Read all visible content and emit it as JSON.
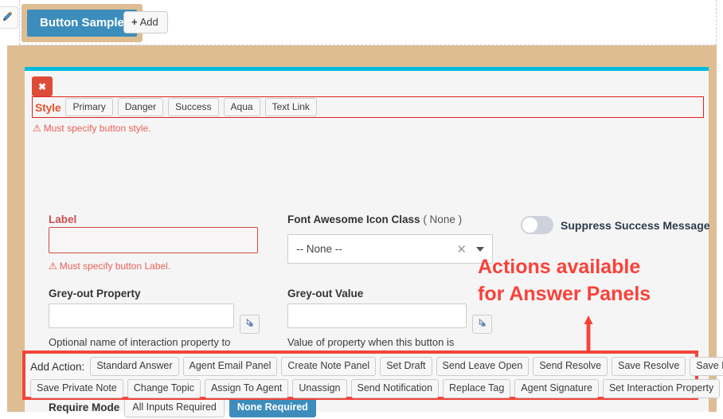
{
  "designer": {
    "edit_icon": "pencil-icon",
    "sample_tab_label": "Button Sample",
    "add_tab_label": "Add",
    "add_tab_plus": "+"
  },
  "panel": {
    "close_glyph": "✖",
    "style": {
      "label": "Style",
      "options": [
        "Primary",
        "Danger",
        "Success",
        "Aqua",
        "Text Link"
      ],
      "error": "Must specify button style.",
      "error_icon": "⚠"
    },
    "label_field": {
      "label": "Label",
      "value": "",
      "error": "Must specify button Label.",
      "error_icon": "⚠"
    },
    "font_awesome": {
      "label": "Font Awesome Icon Class",
      "label_note": "( None )",
      "selected": "-- None --",
      "clear_glyph": "✕",
      "caret": "caret-down-icon"
    },
    "suppress_toggle": {
      "label": "Suppress Success Message",
      "state": "off"
    },
    "greyout_property": {
      "label": "Grey-out Property",
      "value": "",
      "picker_icon": "pointer-icon",
      "helper": "Optional name of interaction property to check to determine if this button is rendered different."
    },
    "greyout_value": {
      "label": "Grey-out Value",
      "value": "",
      "picker_icon": "pointer-icon",
      "helper": "Value of property when this button is normal. If the property is NOT this value, the button will be colored grey."
    },
    "require_mode": {
      "label": "Require Mode",
      "options": [
        "All Inputs Required",
        "None Required"
      ],
      "selected": "None Required"
    },
    "add_action": {
      "label": "Add Action:",
      "row1": [
        "Standard Answer",
        "Agent Email Panel",
        "Create Note Panel",
        "Set Draft",
        "Send Leave Open",
        "Send Resolve",
        "Save Resolve",
        "Save Public Note"
      ],
      "row2": [
        "Save Private Note",
        "Change Topic",
        "Assign To Agent",
        "Unassign",
        "Send Notification",
        "Replace Tag",
        "Agent Signature",
        "Set Interaction Property"
      ]
    }
  },
  "annotation": {
    "line1": "Actions available",
    "line2": "for Answer Panels",
    "arrow": "up-arrow-icon",
    "color": "#f9423a"
  },
  "colors": {
    "tan_frame": "#debd92",
    "card_top_bar": "#00bcdd",
    "primary_blue": "#3d8dbc",
    "danger_red": "#dd4b39",
    "error_text": "#e8625a",
    "annotation_red": "#f9423a"
  }
}
